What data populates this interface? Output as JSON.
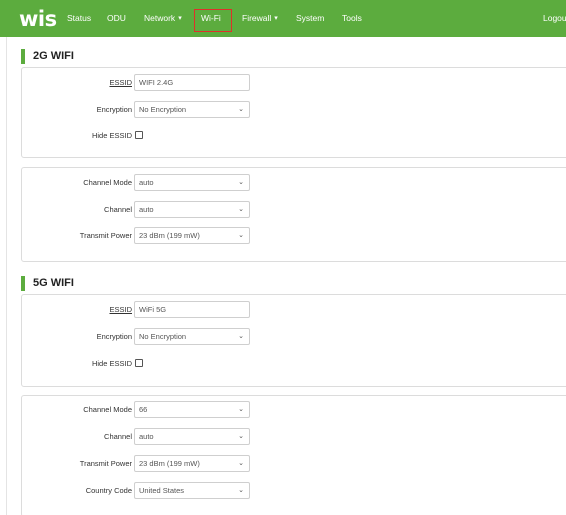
{
  "nav": {
    "logo": "wis",
    "items": [
      {
        "label": "Status",
        "dropdown": false
      },
      {
        "label": "ODU",
        "dropdown": false
      },
      {
        "label": "Network",
        "dropdown": true
      },
      {
        "label": "Wi-Fi",
        "dropdown": false,
        "active": true
      },
      {
        "label": "Firewall",
        "dropdown": true
      },
      {
        "label": "System",
        "dropdown": false
      },
      {
        "label": "Tools",
        "dropdown": false
      }
    ],
    "logout": "Logout",
    "dropdown_icon": "chevron-down-icon",
    "accent": "#5cac3e",
    "active_border": "#e0302a"
  },
  "wifi_2g": {
    "title": "2G WIFI",
    "basic": {
      "essid_label": "ESSID",
      "essid_value": "WIFI 2.4G",
      "encryption_label": "Encryption",
      "encryption_value": "No Encryption",
      "hide_label": "Hide ESSID",
      "hide_checked": false
    },
    "radio": {
      "channel_mode_label": "Channel Mode",
      "channel_mode_value": "auto",
      "channel_label": "Channel",
      "channel_value": "auto",
      "tx_power_label": "Transmit Power",
      "tx_power_value": "23 dBm (199 mW)"
    }
  },
  "wifi_5g": {
    "title": "5G WIFI",
    "basic": {
      "essid_label": "ESSID",
      "essid_value": "WiFi 5G",
      "encryption_label": "Encryption",
      "encryption_value": "No Encryption",
      "hide_label": "Hide ESSID",
      "hide_checked": false
    },
    "radio": {
      "channel_mode_label": "Channel Mode",
      "channel_mode_value": "66",
      "channel_label": "Channel",
      "channel_value": "auto",
      "tx_power_label": "Transmit Power",
      "tx_power_value": "23 dBm (199 mW)",
      "country_label": "Country Code",
      "country_value": "United States"
    }
  },
  "select_icon": "chevron-down-icon"
}
